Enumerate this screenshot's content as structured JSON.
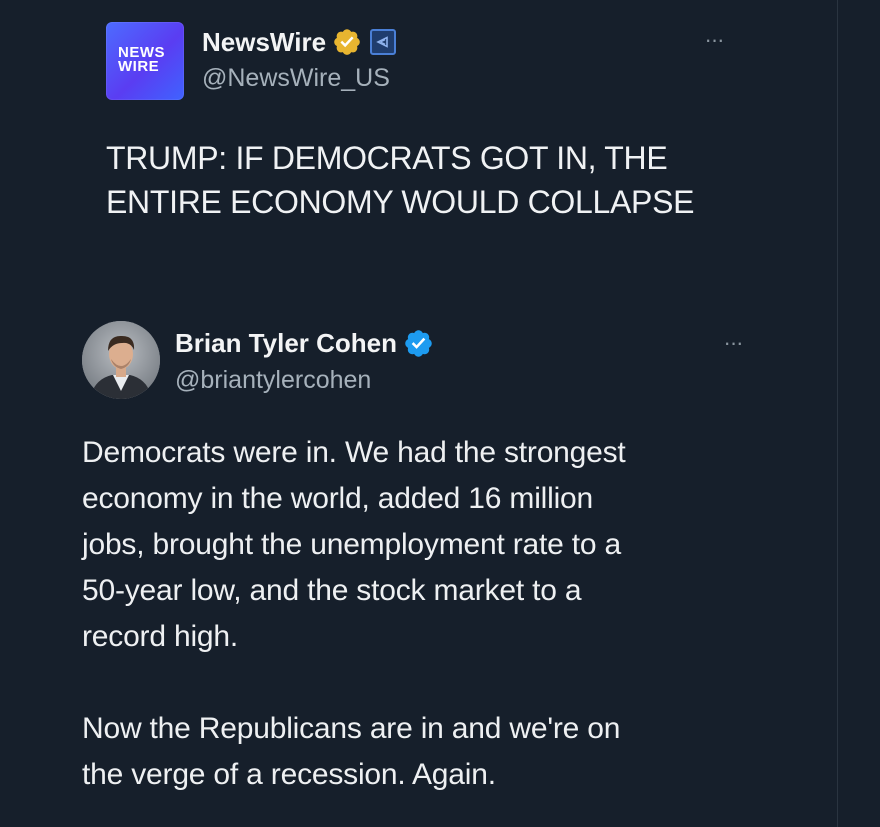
{
  "quoted_tweet": {
    "logo_line1": "NEWS",
    "logo_line2": "WIRE",
    "name": "NewsWire",
    "handle": "@NewsWire_US",
    "more_label": "···",
    "text_line1": "TRUMP: IF DEMOCRATS GOT IN, THE",
    "text_line2": "ENTIRE ECONOMY WOULD COLLAPSE",
    "badges": [
      "gold-verified-icon",
      "affiliate-badge-icon"
    ]
  },
  "reply_tweet": {
    "name": "Brian Tyler Cohen",
    "handle": "@briantylercohen",
    "more_label": "···",
    "paragraph1_lines": [
      "Democrats were in. We had the strongest",
      "economy in the world, added 16 million",
      "jobs, brought the unemployment rate to a",
      "50-year low, and the stock market to a",
      "record high."
    ],
    "paragraph2_lines": [
      "Now the Republicans are in and we're on",
      "the verge of a recession. Again."
    ],
    "badges": [
      "blue-verified-icon"
    ]
  },
  "colors": {
    "background": "#161f2b",
    "text_primary": "#e7e9ea",
    "text_secondary": "#a6b1bb",
    "gold_badge": "#e8b530",
    "blue_badge": "#1d9bf0",
    "logo_gradient_start": "#4d6cff",
    "logo_gradient_end": "#5a3df2"
  }
}
